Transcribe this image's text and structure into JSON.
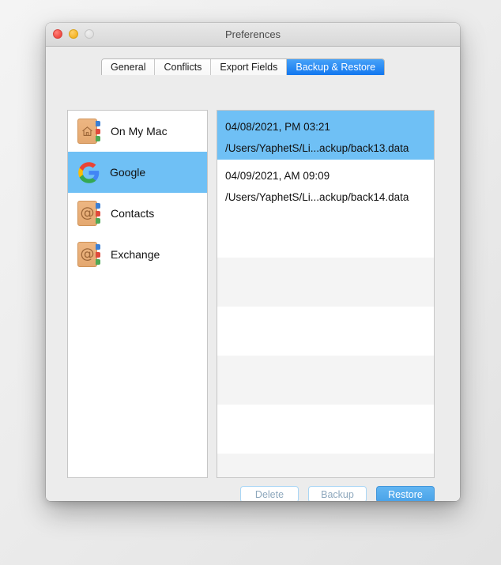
{
  "window": {
    "title": "Preferences",
    "traffic_lights": [
      {
        "name": "close",
        "color": "#f04a42",
        "enabled": true
      },
      {
        "name": "minimize",
        "color": "#f5b528",
        "enabled": true
      },
      {
        "name": "zoom",
        "color": "#e0e0e0",
        "enabled": false
      }
    ]
  },
  "tabs": [
    {
      "label": "General",
      "active": false
    },
    {
      "label": "Conflicts",
      "active": false
    },
    {
      "label": "Export Fields",
      "active": false
    },
    {
      "label": "Backup & Restore",
      "active": true
    }
  ],
  "accent_color": "#1277ef",
  "selection_color": "#6fc0f5",
  "sidebar": {
    "items": [
      {
        "label": "On My Mac",
        "icon": "address-book-house-icon",
        "selected": false
      },
      {
        "label": "Google",
        "icon": "google-logo-icon",
        "selected": true
      },
      {
        "label": "Contacts",
        "icon": "address-book-at-icon",
        "selected": false
      },
      {
        "label": "Exchange",
        "icon": "address-book-at-icon",
        "selected": false
      }
    ]
  },
  "backup_list": {
    "rows": [
      {
        "date": "04/08/2021, PM 03:21",
        "path": "/Users/YaphetS/Li...ackup/back13.data",
        "selected": true,
        "empty": false
      },
      {
        "date": "04/09/2021, AM 09:09",
        "path": "/Users/YaphetS/Li...ackup/back14.data",
        "selected": false,
        "empty": false
      },
      {
        "date": "",
        "path": "",
        "selected": false,
        "empty": true
      },
      {
        "date": "",
        "path": "",
        "selected": false,
        "empty": true
      },
      {
        "date": "",
        "path": "",
        "selected": false,
        "empty": true
      },
      {
        "date": "",
        "path": "",
        "selected": false,
        "empty": true
      },
      {
        "date": "",
        "path": "",
        "selected": false,
        "empty": true
      },
      {
        "date": "",
        "path": "",
        "selected": false,
        "empty": true
      }
    ]
  },
  "footer_buttons": [
    {
      "label": "Delete",
      "style": "muted"
    },
    {
      "label": "Backup",
      "style": "muted"
    },
    {
      "label": "Restore",
      "style": "default"
    }
  ]
}
